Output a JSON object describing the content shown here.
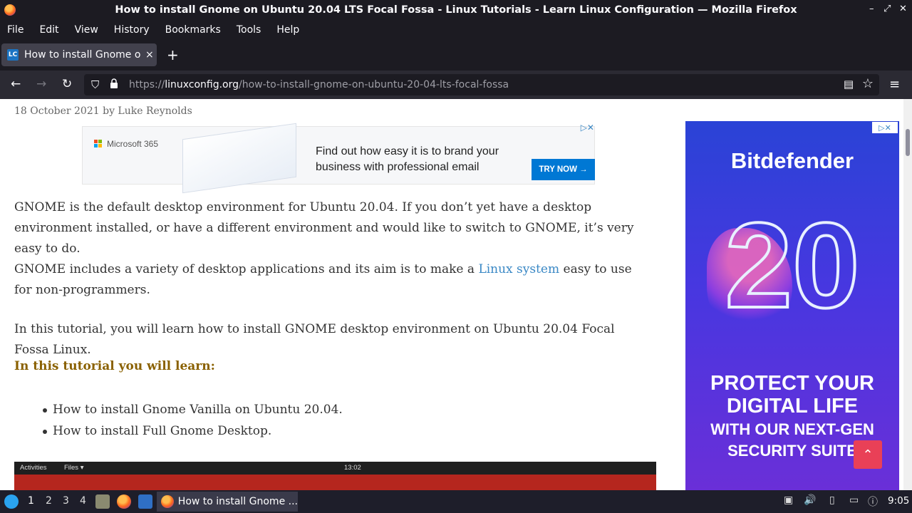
{
  "window": {
    "title": "How to install Gnome on Ubuntu 20.04 LTS Focal Fossa - Linux Tutorials - Learn Linux Configuration — Mozilla Firefox",
    "controls": [
      "–",
      "⤢",
      "✕"
    ]
  },
  "menu": [
    "File",
    "Edit",
    "View",
    "History",
    "Bookmarks",
    "Tools",
    "Help"
  ],
  "tab": {
    "favicon": "LC",
    "label": "How to install Gnome on",
    "close": "×",
    "new_tab": "+"
  },
  "nav": {
    "back": "←",
    "forward": "→",
    "reload": "↻",
    "url_prefix": "https://",
    "url_domain": "linuxconfig.org",
    "url_path": "/how-to-install-gnome-on-ubuntu-20-04-lts-focal-fossa",
    "menu": "≡"
  },
  "article": {
    "byline": "18 October 2021 by Luke Reynolds",
    "p1": "GNOME is the default desktop environment for Ubuntu 20.04. If you don’t yet have a desktop environment installed, or have a different environment and would like to switch to GNOME, it’s very easy to do.",
    "p2_before": "GNOME includes a variety of desktop applications and its aim is to make a ",
    "p2_link": "Linux system",
    "p2_after": " easy to use for non-programmers.",
    "p3": "In this tutorial, you will learn how to install GNOME desktop environment on Ubuntu 20.04 Focal Fossa Linux.",
    "learn_heading": "In this tutorial you will learn:",
    "bullets": [
      "How to install Gnome Vanilla on Ubuntu 20.04.",
      "How to install Full Gnome Desktop."
    ],
    "screenshot": {
      "activities": "Activities",
      "files": "Files ▾",
      "time": "13:02"
    }
  },
  "ad_top": {
    "brand": "Microsoft 365",
    "headline": "Find out how easy it is to brand your business with professional email",
    "cta": "TRY NOW →",
    "ad_mark": "▷✕"
  },
  "ad_side": {
    "brand": "Bitdefender",
    "number": "20",
    "line1": "PROTECT YOUR",
    "line2": "DIGITAL LIFE",
    "line3": "WITH OUR NEXT-GEN",
    "line4": "SECURITY SUITE",
    "ad_mark": "▷✕"
  },
  "back_to_top": "⌃",
  "taskbar": {
    "workspaces": [
      "1",
      "2",
      "3",
      "4"
    ],
    "active_window": "How to install Gnome ...",
    "clock": "9:05"
  },
  "colors": {
    "link": "#3a88c5",
    "heading_gold": "#8a6100",
    "back_to_top": "#e94057",
    "ms_blue": "#0078d4"
  }
}
